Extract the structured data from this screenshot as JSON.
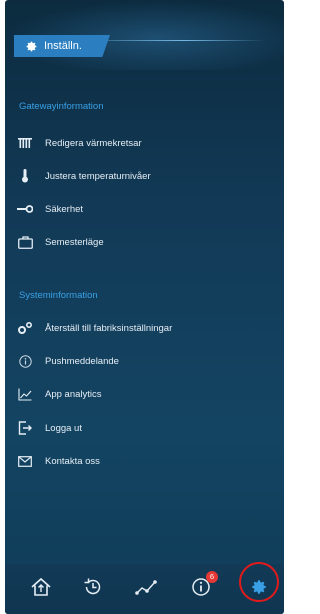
{
  "header": {
    "tab_label": "Inställn."
  },
  "sections": {
    "gateway": {
      "title": "Gatewayinformation",
      "items": [
        {
          "label": "Redigera värmekretsar",
          "icon": "radiator-icon"
        },
        {
          "label": "Justera temperaturnivåer",
          "icon": "thermometer-icon"
        },
        {
          "label": "Säkerhet",
          "icon": "key-icon"
        },
        {
          "label": "Semesterläge",
          "icon": "suitcase-icon"
        }
      ]
    },
    "system": {
      "title": "Systeminformation",
      "items": [
        {
          "label": "Återställ till fabriksinställningar",
          "icon": "reset-gears-icon"
        },
        {
          "label": "Pushmeddelande",
          "icon": "info-circle-icon"
        },
        {
          "label": "App analytics",
          "icon": "chart-line-icon"
        },
        {
          "label": "Logga ut",
          "icon": "logout-icon"
        },
        {
          "label": "Kontakta oss",
          "icon": "envelope-icon"
        }
      ]
    }
  },
  "tabbar": {
    "items": [
      {
        "name": "home",
        "icon": "home-icon"
      },
      {
        "name": "history",
        "icon": "history-icon"
      },
      {
        "name": "graph",
        "icon": "graph-icon"
      },
      {
        "name": "info",
        "icon": "info-icon",
        "badge": "6"
      },
      {
        "name": "settings",
        "icon": "gear-icon"
      }
    ]
  },
  "colors": {
    "accent": "#2b7fc0",
    "section_title": "#3aa0e6",
    "badge": "#e53935",
    "highlight": "#e11b1b"
  }
}
